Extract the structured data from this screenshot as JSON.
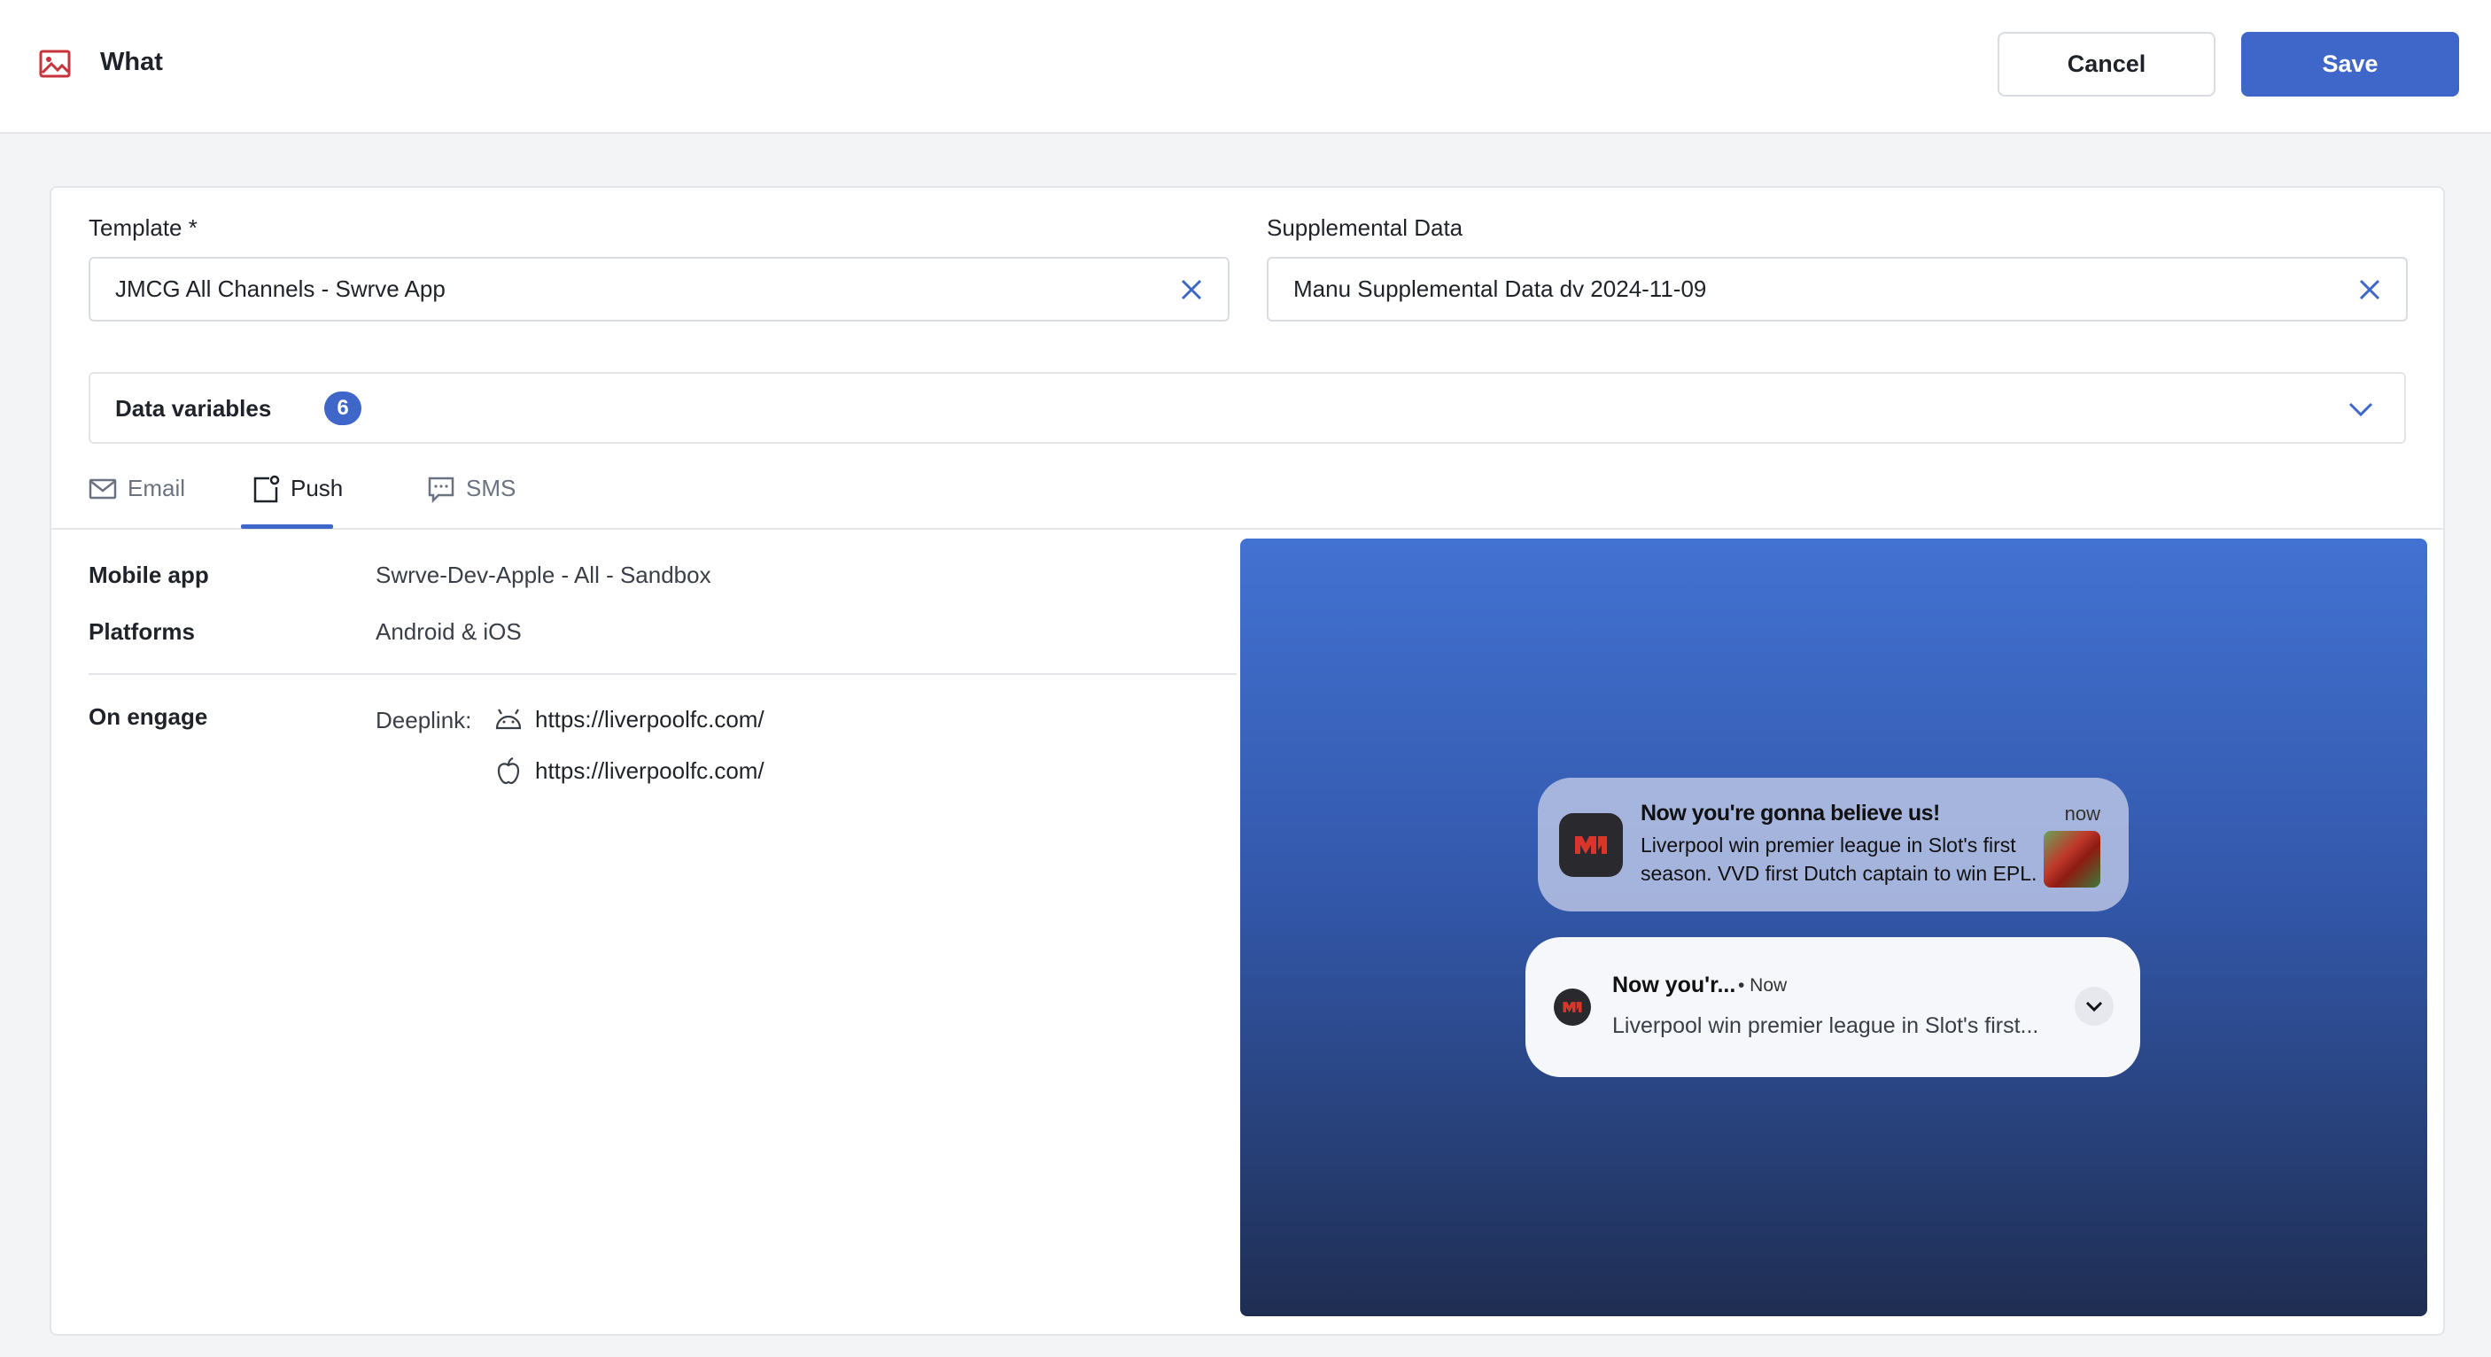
{
  "header": {
    "title": "What",
    "icon": "image-icon",
    "cancel_label": "Cancel",
    "save_label": "Save"
  },
  "template": {
    "label": "Template *",
    "value": "JMCG All Channels - Swrve App"
  },
  "supplemental": {
    "label": "Supplemental Data",
    "value": "Manu Supplemental Data dv 2024-11-09"
  },
  "data_variables": {
    "label": "Data variables",
    "count": "6"
  },
  "tabs": [
    {
      "label": "Email",
      "icon": "envelope-icon",
      "active": false
    },
    {
      "label": "Push",
      "icon": "push-notification-icon",
      "active": true
    },
    {
      "label": "SMS",
      "icon": "chat-bubble-icon",
      "active": false
    }
  ],
  "details": {
    "mobile_app_label": "Mobile app",
    "mobile_app_value": "Swrve-Dev-Apple - All - Sandbox",
    "platforms_label": "Platforms",
    "platforms_value": "Android & iOS",
    "on_engage_label": "On engage",
    "deeplink_label": "Deeplink:",
    "android_link": "https://liverpoolfc.com/",
    "ios_link": "https://liverpoolfc.com/"
  },
  "preview": {
    "ios": {
      "title": "Now you're gonna believe us!",
      "time": "now",
      "body": "Liverpool win premier league in Slot's first season. VVD first Dutch captain to win EPL."
    },
    "android": {
      "title": "Now you'r...",
      "time": "• Now",
      "body": "Liverpool win premier league in Slot's first..."
    }
  },
  "colors": {
    "accent": "#3f66c9",
    "header_icon": "#c8323a",
    "app_logo": "#d9362b"
  }
}
